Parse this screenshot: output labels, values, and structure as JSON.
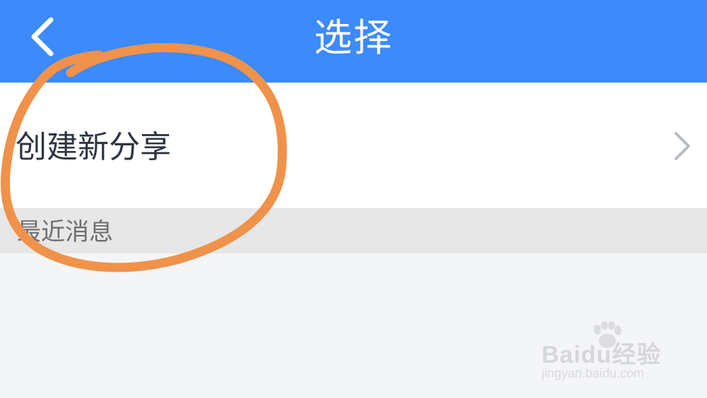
{
  "header": {
    "title": "选择",
    "back_icon": "chevron-left-icon",
    "background_color": "#3c8afb"
  },
  "menu": {
    "items": [
      {
        "label": "创建新分享",
        "icon": "chevron-right-icon"
      }
    ]
  },
  "section": {
    "label": "最近消息"
  },
  "annotation": {
    "shape": "hand-drawn-circle",
    "color": "#f0924a"
  },
  "watermark": {
    "brand": "Baidu经验",
    "url": "jingyan.baidu.com"
  }
}
